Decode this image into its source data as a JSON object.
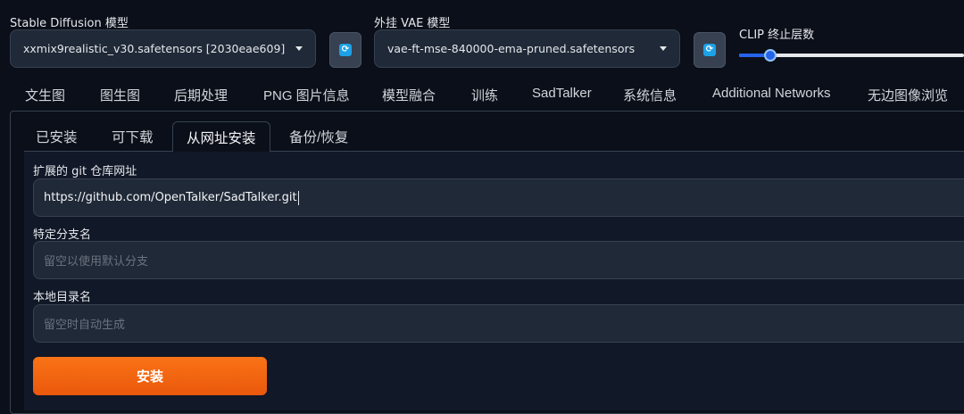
{
  "header": {
    "sd_model_label": "Stable Diffusion 模型",
    "sd_model_value": "xxmix9realistic_v30.safetensors [2030eae609]",
    "vae_label": "外挂 VAE 模型",
    "vae_value": "vae-ft-mse-840000-ema-pruned.safetensors",
    "clip_label": "CLIP 终止层数",
    "refresh_icon_glyph": "⟳",
    "clip_skip_fraction": 0.14
  },
  "main_tabs": [
    "文生图",
    "图生图",
    "后期处理",
    "PNG 图片信息",
    "模型融合",
    "训练",
    "SadTalker",
    "系统信息",
    "Additional Networks",
    "无边图像浏览"
  ],
  "sub_tabs": [
    "已安装",
    "可下载",
    "从网址安装",
    "备份/恢复"
  ],
  "form": {
    "repo_label": "扩展的 git 仓库网址",
    "repo_value": "https://github.com/OpenTalker/SadTalker.git",
    "branch_label": "特定分支名",
    "branch_placeholder": "留空以使用默认分支",
    "dir_label": "本地目录名",
    "dir_placeholder": "留空时自动生成",
    "install_label": "安装"
  },
  "colors": {
    "background": "#0b0f19",
    "accent": "#2563eb",
    "install_button": "#f97316",
    "refresh_icon": "#1da1e8"
  }
}
